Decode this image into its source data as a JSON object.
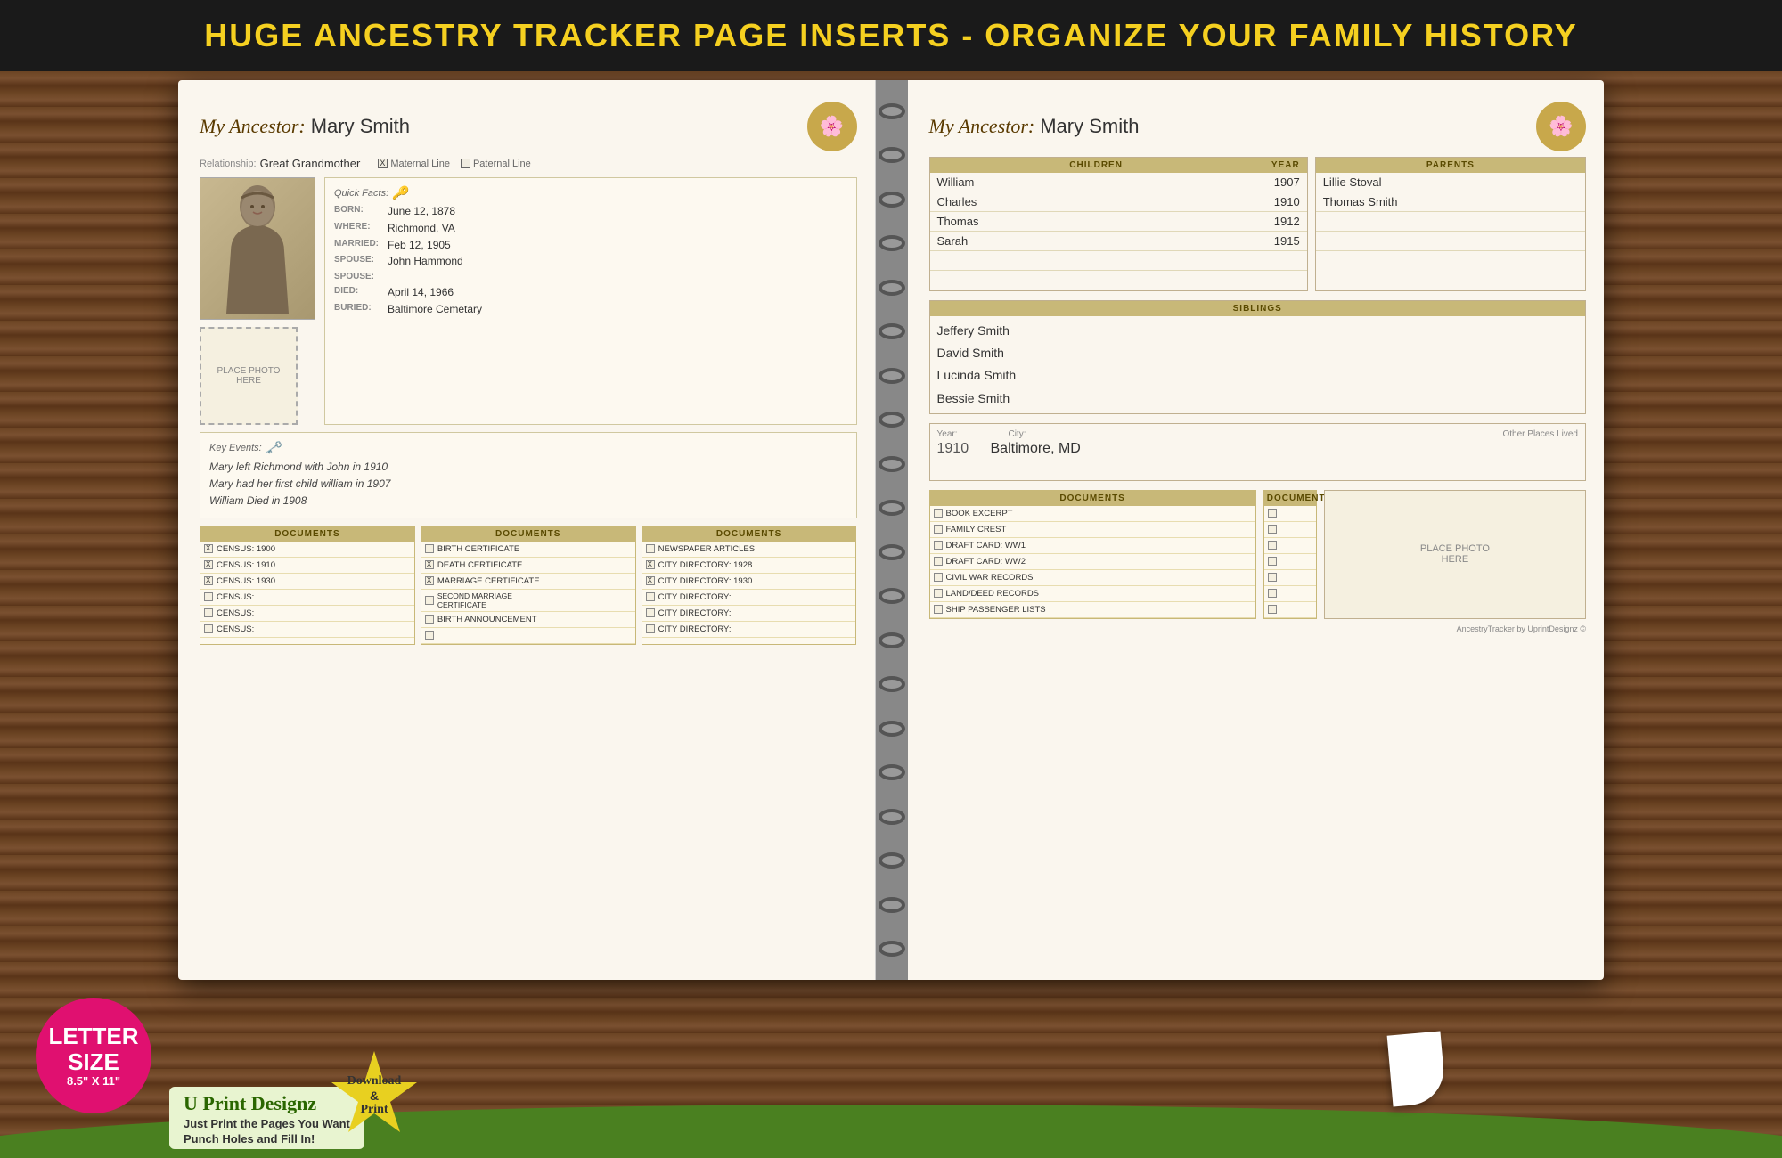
{
  "banner": {
    "text": "HUGE ANCESTRY TRACKER PAGE INSERTS - ORGANIZE YOUR FAMILY HISTORY"
  },
  "left_page": {
    "ancestor_label": "My Ancestor:",
    "ancestor_name": "Mary Smith",
    "relationship_label": "Relationship:",
    "relationship_value": "Great Grandmother",
    "maternal_line": "Maternal Line",
    "paternal_line": "Paternal Line",
    "quick_facts_title": "Quick Facts:",
    "facts": [
      {
        "label": "BORN:",
        "value": "June 12, 1878"
      },
      {
        "label": "WHERE:",
        "value": "Richmond, VA"
      },
      {
        "label": "MARRIED:",
        "value": "Feb 12, 1905"
      },
      {
        "label": "SPOUSE:",
        "value": "John Hammond"
      },
      {
        "label": "SPOUSE:",
        "value": ""
      },
      {
        "label": "DIED:",
        "value": "April 14, 1966"
      },
      {
        "label": "BURIED:",
        "value": "Baltimore Cemetary"
      }
    ],
    "key_events_title": "Key Events:",
    "events": [
      "Mary left Richmond with John in 1910",
      "Mary had her first child william in 1907",
      "William Died in 1908"
    ],
    "place_photo_here": "PLACE PHOTO\nHERE",
    "doc_columns": [
      {
        "header": "DOCUMENTS",
        "items": [
          {
            "label": "CENSUS: 1900",
            "checked": true
          },
          {
            "label": "CENSUS: 1910",
            "checked": true
          },
          {
            "label": "CENSUS: 1930",
            "checked": true
          },
          {
            "label": "CENSUS:",
            "checked": false
          },
          {
            "label": "CENSUS:",
            "checked": false
          },
          {
            "label": "CENSUS:",
            "checked": false
          }
        ]
      },
      {
        "header": "DOCUMENTS",
        "items": [
          {
            "label": "BIRTH CERTIFICATE",
            "checked": false
          },
          {
            "label": "DEATH CERTIFICATE",
            "checked": true
          },
          {
            "label": "MARRIAGE CERTIFICATE",
            "checked": true
          },
          {
            "label": "SECOND MARRIAGE CERTIFICATE",
            "checked": false
          },
          {
            "label": "BIRTH ANNOUNCEMENT",
            "checked": false
          },
          {
            "label": "",
            "checked": false
          }
        ]
      },
      {
        "header": "DOCUMENTS",
        "items": [
          {
            "label": "NEWSPAPER ARTICLES",
            "checked": false
          },
          {
            "label": "CITY DIRECTORY: 1928",
            "checked": true
          },
          {
            "label": "CITY DIRECTORY: 1930",
            "checked": true
          },
          {
            "label": "CITY DIRECTORY:",
            "checked": false
          },
          {
            "label": "CITY DIRECTORY:",
            "checked": false
          },
          {
            "label": "CITY DIRECTORY:",
            "checked": false
          }
        ]
      }
    ]
  },
  "right_page": {
    "ancestor_label": "My Ancestor:",
    "ancestor_name": "Mary Smith",
    "children_header": "CHILDREN",
    "year_header": "YEAR",
    "parents_header": "PARENTS",
    "children": [
      {
        "name": "William",
        "year": "1907"
      },
      {
        "name": "Charles",
        "year": "1910"
      },
      {
        "name": "Thomas",
        "year": "1912"
      },
      {
        "name": "Sarah",
        "year": "1915"
      }
    ],
    "parents": [
      "Lillie Stoval",
      "Thomas Smith"
    ],
    "siblings_header": "SIBLINGS",
    "siblings": [
      "Jeffery Smith",
      "David Smith",
      "Lucinda Smith",
      "Bessie Smith"
    ],
    "places_labels": {
      "year": "Year:",
      "city": "City:",
      "other": "Other Places Lived"
    },
    "places": [
      {
        "year": "1910",
        "city": "Baltimore, MD"
      }
    ],
    "place_photo_here": "PLACE PHOTO\nHERE",
    "doc_columns": [
      {
        "header": "DOCUMENTS",
        "items": [
          {
            "label": "BOOK EXCERPT",
            "checked": false
          },
          {
            "label": "FAMILY CREST",
            "checked": false
          },
          {
            "label": "DRAFT CARD: WW1",
            "checked": false
          },
          {
            "label": "DRAFT CARD: WW2",
            "checked": false
          },
          {
            "label": "CIVIL WAR RECORDS",
            "checked": false
          },
          {
            "label": "LAND/DEED RECORDS",
            "checked": false
          },
          {
            "label": "SHIP PASSENGER LISTS",
            "checked": false
          }
        ]
      },
      {
        "header": "DOCUMENTS",
        "items": [
          {
            "label": "",
            "checked": false
          },
          {
            "label": "",
            "checked": false
          },
          {
            "label": "",
            "checked": false
          },
          {
            "label": "",
            "checked": false
          },
          {
            "label": "",
            "checked": false
          },
          {
            "label": "",
            "checked": false
          },
          {
            "label": "",
            "checked": false
          }
        ]
      }
    ],
    "footer_text": "AncestryTracker by UprintDesignz ©"
  },
  "bottom": {
    "letter_size_line1": "LETTER",
    "letter_size_line2": "SIZE",
    "letter_size_dims": "8.5\" X 11\"",
    "brand_name": "U Print Designz",
    "brand_tagline": "Just Print the Pages You Want",
    "brand_tagline2": "Punch Holes and Fill In!",
    "download_line1": "Download",
    "download_line2": "&",
    "download_line3": "Print"
  }
}
